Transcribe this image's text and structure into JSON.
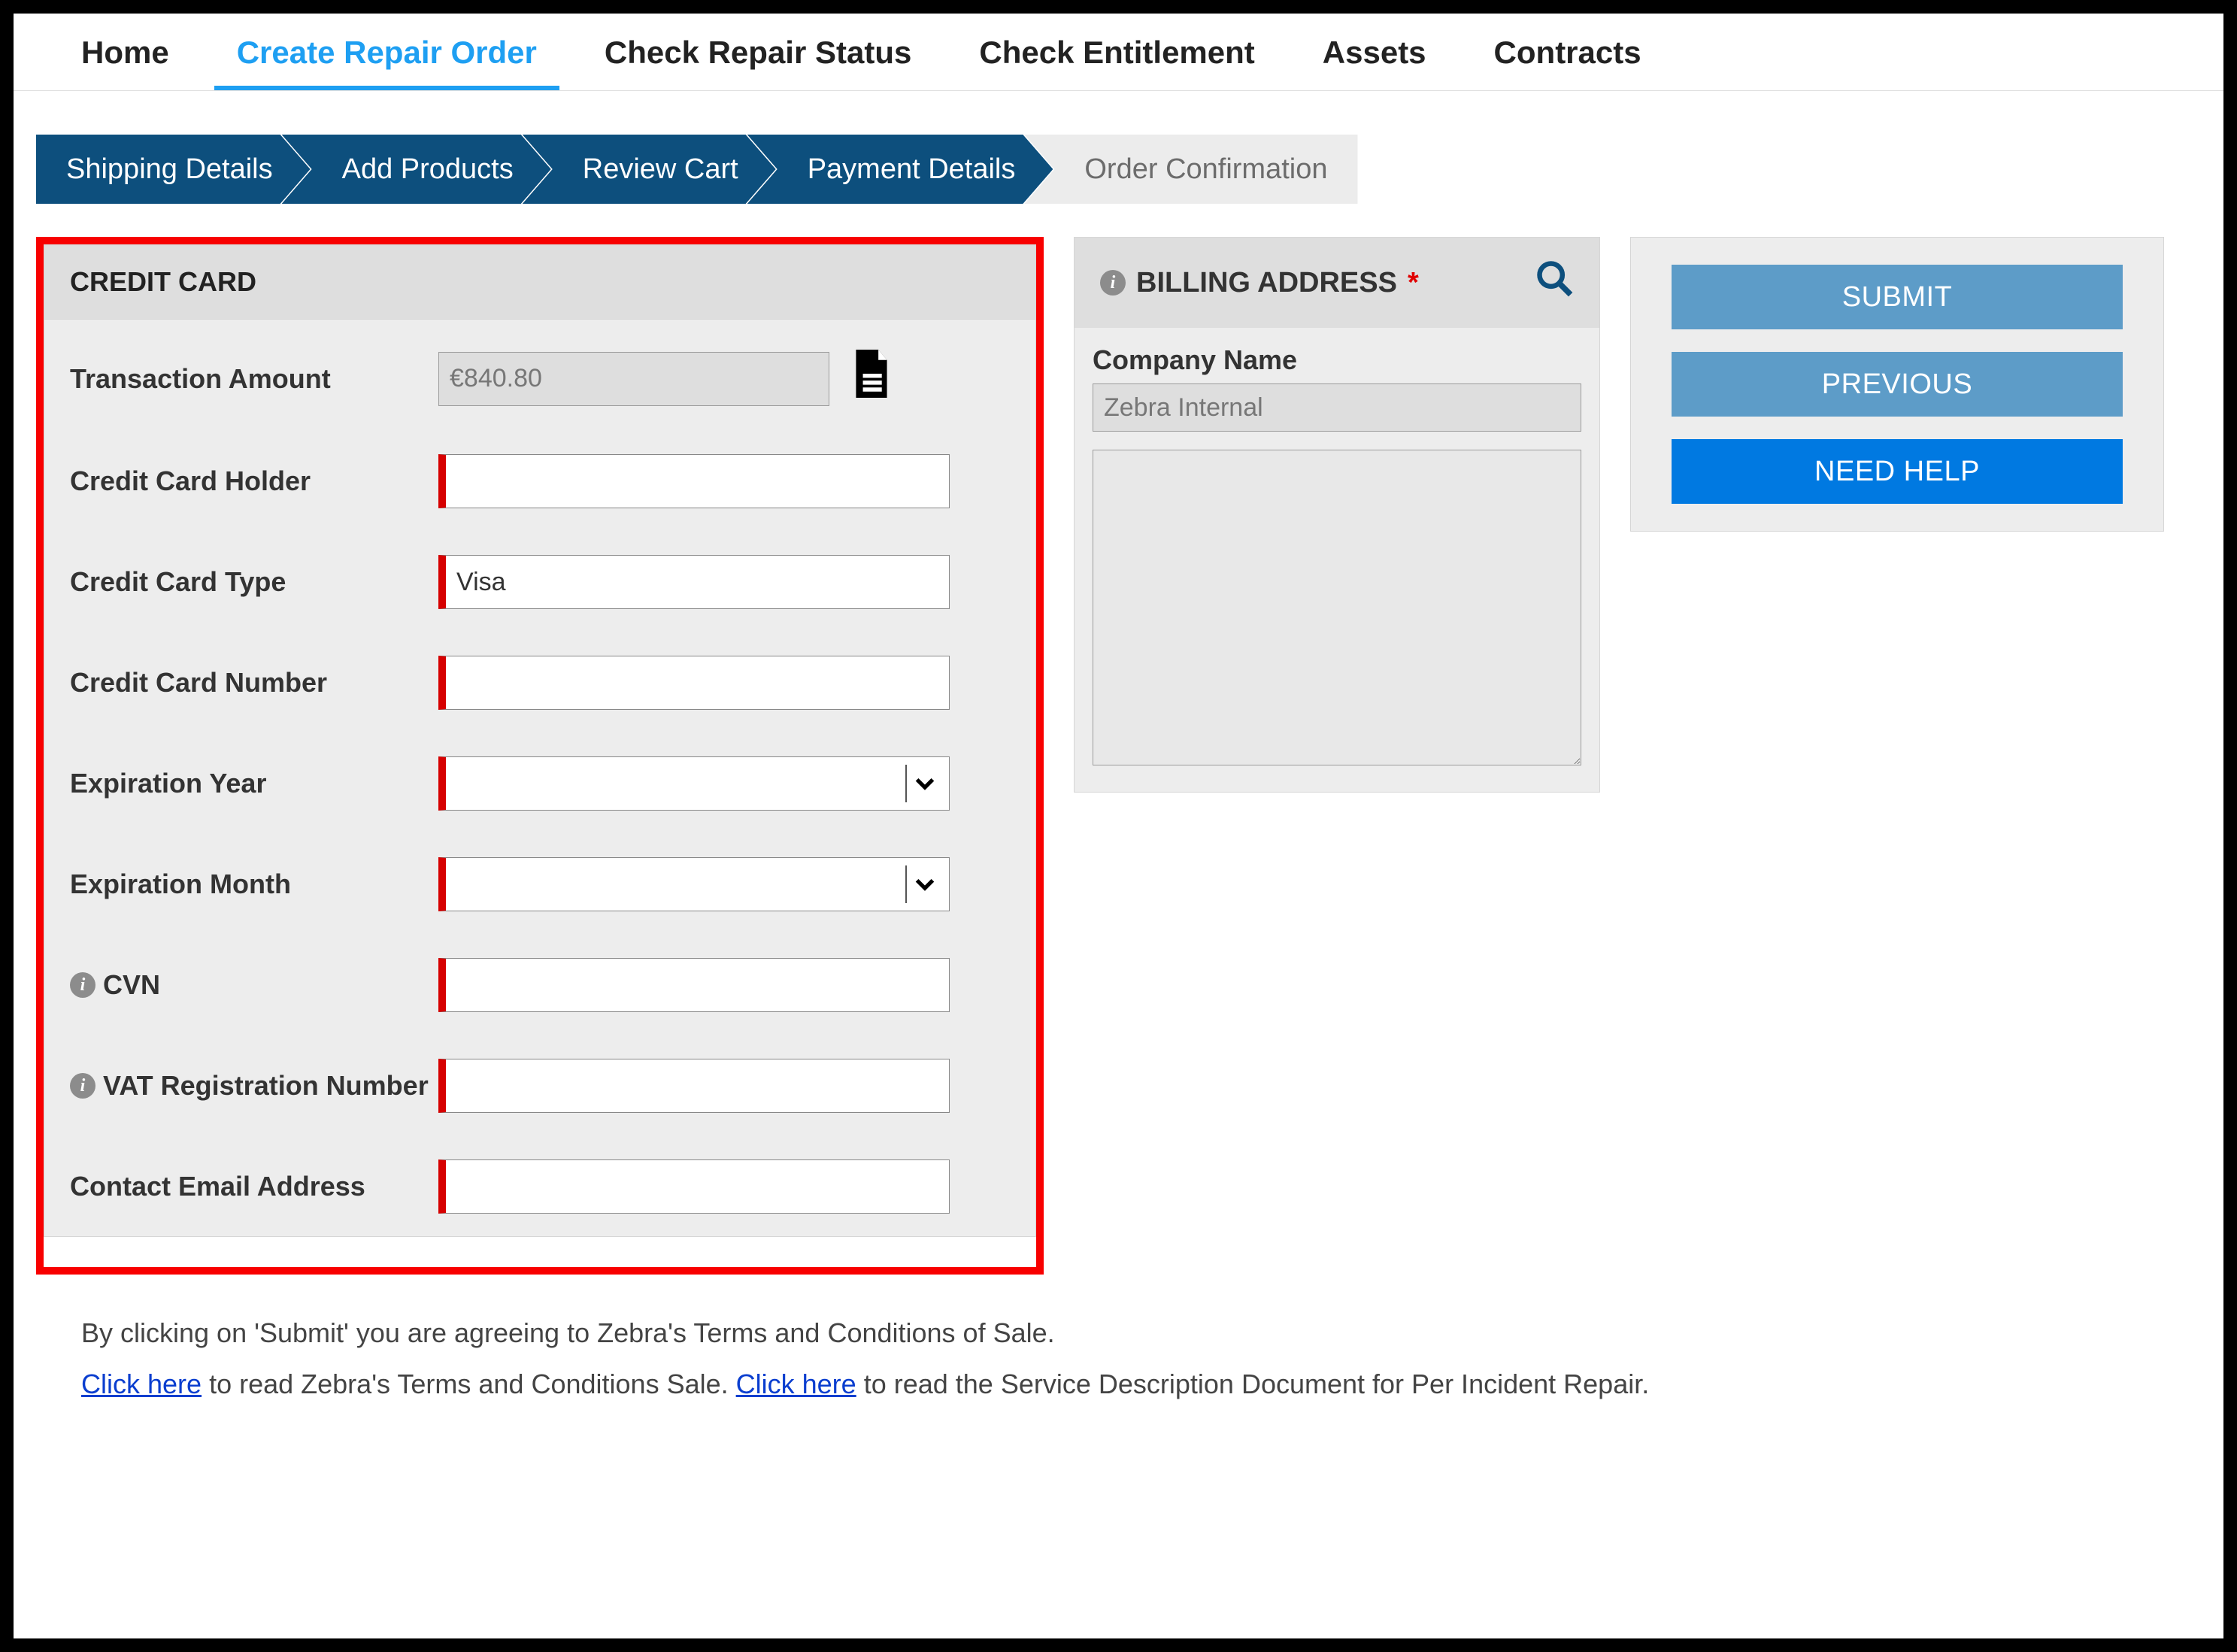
{
  "nav": {
    "home": "Home",
    "create": "Create Repair Order",
    "check_status": "Check Repair Status",
    "check_entitlement": "Check Entitlement",
    "assets": "Assets",
    "contracts": "Contracts"
  },
  "steps": {
    "shipping": "Shipping Details",
    "add_products": "Add Products",
    "review": "Review Cart",
    "payment": "Payment Details",
    "confirm": "Order Confirmation"
  },
  "cc": {
    "header": "CREDIT CARD",
    "transaction_amount_label": "Transaction Amount",
    "transaction_amount_value": "€840.80",
    "holder_label": "Credit Card Holder",
    "holder_value": "",
    "type_label": "Credit Card Type",
    "type_value": "Visa",
    "number_label": "Credit Card Number",
    "number_value": "",
    "exp_year_label": "Expiration Year",
    "exp_year_value": "",
    "exp_month_label": "Expiration Month",
    "exp_month_value": "",
    "cvn_label": "CVN",
    "cvn_value": "",
    "vat_label": "VAT Registration Number",
    "vat_value": "",
    "contact_email_label": "Contact Email Address",
    "contact_email_value": ""
  },
  "billing": {
    "header": "BILLING ADDRESS",
    "company_label": "Company Name",
    "company_value": "Zebra Internal",
    "address_value": ""
  },
  "actions": {
    "submit": "SUBMIT",
    "previous": "PREVIOUS",
    "help": "NEED HELP"
  },
  "footer": {
    "line1_a": "By clicking on 'Submit' you are agreeing to Zebra's Terms and Conditions of Sale.",
    "click_here": "Click here",
    "line2_mid1": " to read Zebra's Terms and Conditions Sale. ",
    "line2_mid2": " to read the Service Description Document for Per Incident Repair."
  },
  "colors": {
    "accent_blue": "#1e9ff2",
    "step_blue": "#0d4f7d",
    "btn_muted": "#5d9cc8",
    "btn_primary": "#0079e1",
    "highlight_red": "#f80000"
  }
}
